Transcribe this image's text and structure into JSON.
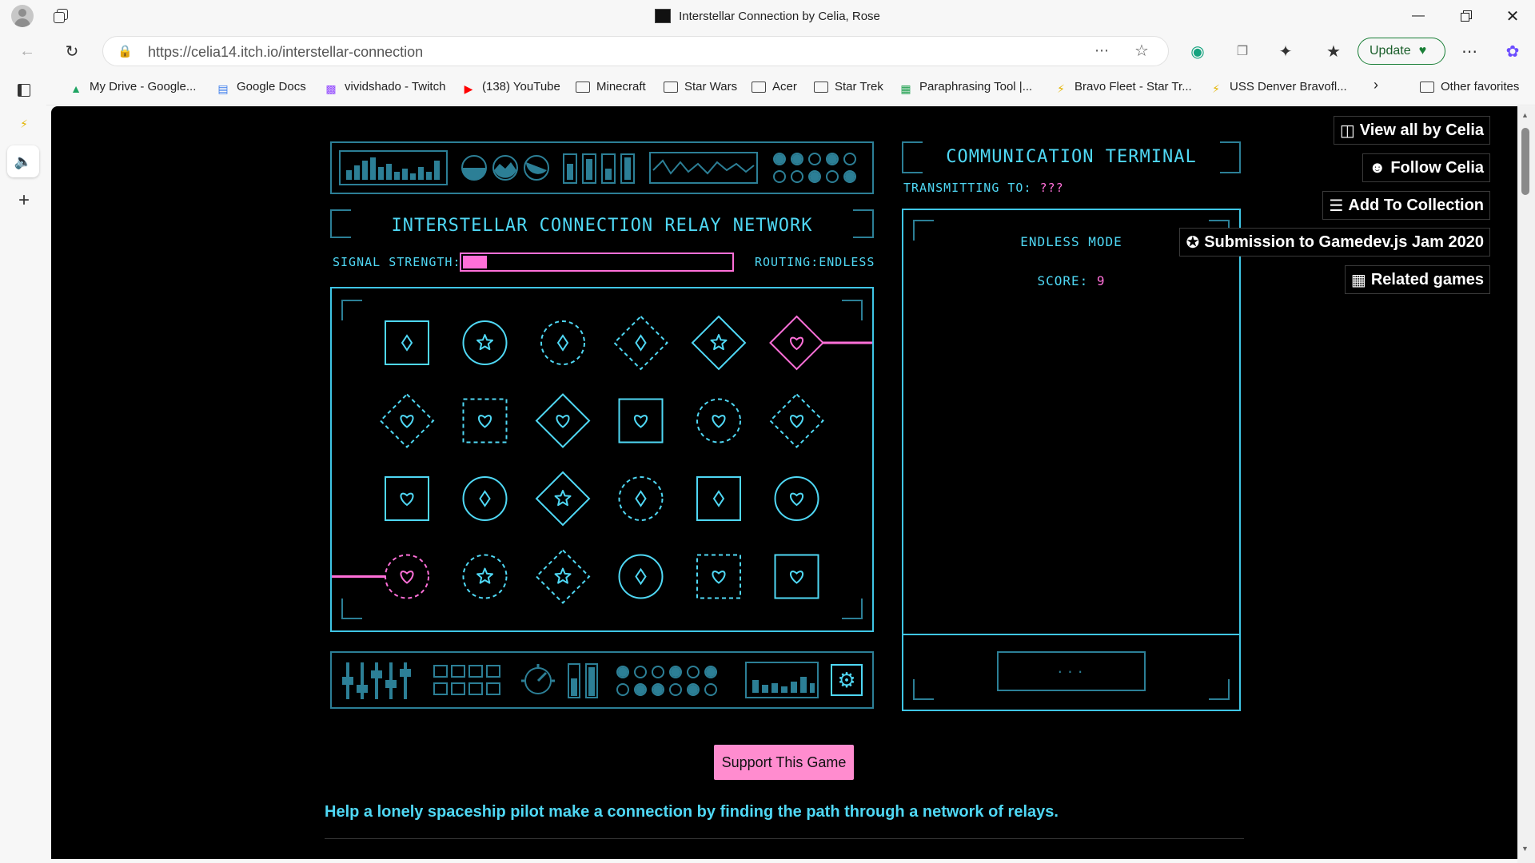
{
  "window": {
    "title": "Interstellar Connection by Celia, Rose",
    "controls": [
      "minimize",
      "restore",
      "close"
    ]
  },
  "nav": {
    "url": "https://celia14.itch.io/interstellar-connection",
    "update_label": "Update"
  },
  "bookmarks": [
    {
      "label": "My Drive - Google...",
      "icon": "drive-icon"
    },
    {
      "label": "Google Docs",
      "icon": "docs-icon"
    },
    {
      "label": "vividshado - Twitch",
      "icon": "twitch-icon"
    },
    {
      "label": "(138) YouTube",
      "icon": "youtube-icon"
    },
    {
      "label": "Minecraft",
      "icon": "folder-icon"
    },
    {
      "label": "Star Wars",
      "icon": "folder-icon"
    },
    {
      "label": "Acer",
      "icon": "folder-icon"
    },
    {
      "label": "Star Trek",
      "icon": "folder-icon"
    },
    {
      "label": "Paraphrasing Tool |...",
      "icon": "paraphrase-icon"
    },
    {
      "label": "Bravo Fleet - Star Tr...",
      "icon": "bolt-icon"
    },
    {
      "label": "USS Denver Bravofl...",
      "icon": "bolt-icon"
    }
  ],
  "bookmarks_other": "Other favorites",
  "game": {
    "relay_title": "INTERSTELLAR CONNECTION RELAY NETWORK",
    "signal_label": "SIGNAL STRENGTH:",
    "signal_fraction": 0.09,
    "routing_label": "ROUTING:ENDLESS",
    "terminal_title": "COMMUNICATION TERMINAL",
    "transmitting_label": "TRANSMITTING TO:",
    "transmitting_value": "???",
    "mode_label": "ENDLESS MODE",
    "score_label": "SCORE:",
    "score_value": "9",
    "input_placeholder": "...",
    "grid": [
      [
        {
          "frame": "square",
          "style": "solid",
          "symbol": "diamond",
          "color": "cyan"
        },
        {
          "frame": "circle",
          "style": "solid",
          "symbol": "star",
          "color": "cyan"
        },
        {
          "frame": "circle",
          "style": "dashed",
          "symbol": "diamond",
          "color": "cyan"
        },
        {
          "frame": "diamond",
          "style": "dashed",
          "symbol": "diamond",
          "color": "cyan"
        },
        {
          "frame": "diamond",
          "style": "solid",
          "symbol": "star",
          "color": "cyan"
        },
        {
          "frame": "diamond",
          "style": "solid",
          "symbol": "heart",
          "color": "pink"
        }
      ],
      [
        {
          "frame": "diamond",
          "style": "dashed",
          "symbol": "heart",
          "color": "cyan"
        },
        {
          "frame": "square",
          "style": "dashed",
          "symbol": "heart",
          "color": "cyan"
        },
        {
          "frame": "diamond",
          "style": "solid",
          "symbol": "heart",
          "color": "cyan"
        },
        {
          "frame": "square",
          "style": "solid",
          "symbol": "heart",
          "color": "cyan"
        },
        {
          "frame": "circle",
          "style": "dashed",
          "symbol": "heart",
          "color": "cyan"
        },
        {
          "frame": "diamond",
          "style": "dashed",
          "symbol": "heart",
          "color": "cyan"
        }
      ],
      [
        {
          "frame": "square",
          "style": "solid",
          "symbol": "heart",
          "color": "cyan"
        },
        {
          "frame": "circle",
          "style": "solid",
          "symbol": "diamond",
          "color": "cyan"
        },
        {
          "frame": "diamond",
          "style": "solid",
          "symbol": "star",
          "color": "cyan"
        },
        {
          "frame": "circle",
          "style": "dashed",
          "symbol": "diamond",
          "color": "cyan"
        },
        {
          "frame": "square",
          "style": "solid",
          "symbol": "diamond",
          "color": "cyan"
        },
        {
          "frame": "circle",
          "style": "solid",
          "symbol": "heart",
          "color": "cyan"
        }
      ],
      [
        {
          "frame": "circle",
          "style": "dashed",
          "symbol": "heart",
          "color": "pink"
        },
        {
          "frame": "circle",
          "style": "dashed",
          "symbol": "star",
          "color": "cyan"
        },
        {
          "frame": "diamond",
          "style": "dashed",
          "symbol": "star",
          "color": "cyan"
        },
        {
          "frame": "circle",
          "style": "solid",
          "symbol": "diamond",
          "color": "cyan"
        },
        {
          "frame": "square",
          "style": "dashed",
          "symbol": "heart",
          "color": "cyan"
        },
        {
          "frame": "square",
          "style": "solid",
          "symbol": "heart",
          "color": "cyan"
        }
      ]
    ]
  },
  "side_buttons": [
    {
      "label": "View all by Celia",
      "icon": "itchio-icon"
    },
    {
      "label": "Follow Celia",
      "icon": "add-user-icon"
    },
    {
      "label": "Add To Collection",
      "icon": "add-list-icon"
    },
    {
      "label": "Submission to Gamedev.js Jam 2020",
      "icon": "award-icon"
    },
    {
      "label": "Related games",
      "icon": "map-icon"
    }
  ],
  "support_label": "Support This Game",
  "description": "Help a lonely spaceship pilot make a connection by finding the path through a network of relays.",
  "colors": {
    "cyan": "#4fd8f5",
    "pink": "#ff6fd8",
    "dim": "#2c7f96",
    "support": "#ff8ccf"
  }
}
